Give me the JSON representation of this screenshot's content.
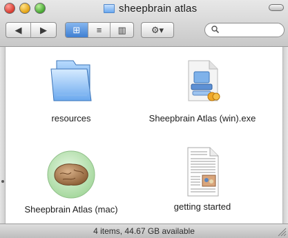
{
  "window": {
    "title": "sheepbrain atlas"
  },
  "toolbar": {
    "back_label": "◀",
    "forward_label": "▶",
    "view_icon_label": "⊞",
    "view_list_label": "≡",
    "view_column_label": "▥",
    "action_label": "⚙▾",
    "search_placeholder": ""
  },
  "items": [
    {
      "label": "resources",
      "icon": "folder-icon"
    },
    {
      "label": "Sheepbrain Atlas (win).exe",
      "icon": "windows-exe-icon"
    },
    {
      "label": "Sheepbrain Atlas (mac)",
      "icon": "sheep-brain-app-icon"
    },
    {
      "label": "getting started",
      "icon": "document-icon"
    }
  ],
  "status": {
    "text": "4 items, 44.67 GB available"
  },
  "colors": {
    "selection": "#3f7fd2",
    "folder_blue": "#6aa8ee",
    "app_green_circle": "#c6ebc0"
  }
}
